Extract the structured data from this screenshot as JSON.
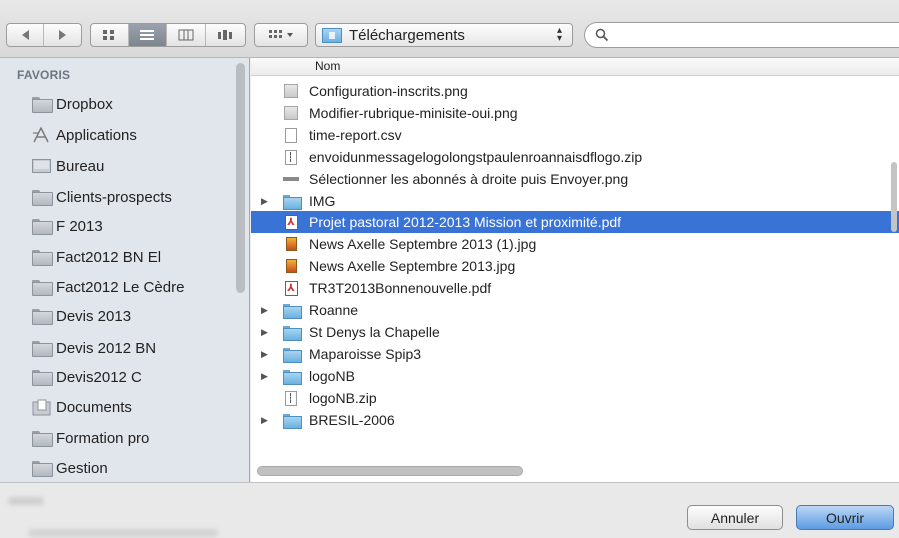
{
  "toolbar": {
    "location": "Téléchargements",
    "search_placeholder": ""
  },
  "sidebar": {
    "header": "FAVORIS",
    "items": [
      {
        "label": "Dropbox",
        "icon": "folder-icon"
      },
      {
        "label": "Applications",
        "icon": "applications-icon"
      },
      {
        "label": "Bureau",
        "icon": "desktop-icon"
      },
      {
        "label": "Clients-prospects",
        "icon": "folder-icon"
      },
      {
        "label": "F 2013",
        "icon": "folder-icon"
      },
      {
        "label": "Fact2012 BN El",
        "icon": "folder-icon"
      },
      {
        "label": "Fact2012 Le Cèdre",
        "icon": "folder-icon"
      },
      {
        "label": "Devis 2013",
        "icon": "folder-icon"
      },
      {
        "label": "Devis 2012 BN",
        "icon": "folder-icon"
      },
      {
        "label": "Devis2012 C",
        "icon": "folder-icon"
      },
      {
        "label": "Documents",
        "icon": "documents-icon"
      },
      {
        "label": "Formation pro",
        "icon": "folder-icon"
      },
      {
        "label": "Gestion",
        "icon": "folder-icon"
      }
    ]
  },
  "filelist": {
    "column_name": "Nom",
    "rows": [
      {
        "name": "Configuration-inscrits.png",
        "type": "png",
        "folder": false
      },
      {
        "name": "Modifier-rubrique-minisite-oui.png",
        "type": "png",
        "folder": false
      },
      {
        "name": "time-report.csv",
        "type": "doc",
        "folder": false
      },
      {
        "name": "envoidunmessagelogolongstpaulenroannaisdflogo.zip",
        "type": "zip",
        "folder": false
      },
      {
        "name": "Sélectionner les abonnés à droite puis Envoyer.png",
        "type": "bar",
        "folder": false
      },
      {
        "name": "IMG",
        "type": "folder",
        "folder": true
      },
      {
        "name": "Projet pastoral 2012-2013 Mission et proximité.pdf",
        "type": "pdf",
        "folder": false,
        "selected": true
      },
      {
        "name": "News Axelle Septembre 2013 (1).jpg",
        "type": "jpg",
        "folder": false
      },
      {
        "name": "News Axelle Septembre 2013.jpg",
        "type": "jpg",
        "folder": false
      },
      {
        "name": "TR3T2013Bonnenouvelle.pdf",
        "type": "pdf",
        "folder": false
      },
      {
        "name": "Roanne",
        "type": "folder",
        "folder": true
      },
      {
        "name": "St Denys la Chapelle",
        "type": "folder",
        "folder": true
      },
      {
        "name": "Maparoisse Spip3",
        "type": "folder",
        "folder": true
      },
      {
        "name": "logoNB",
        "type": "folder",
        "folder": true
      },
      {
        "name": "logoNB.zip",
        "type": "zip",
        "folder": false
      },
      {
        "name": "BRESIL-2006",
        "type": "folder",
        "folder": true
      }
    ]
  },
  "buttons": {
    "cancel": "Annuler",
    "open": "Ouvrir"
  },
  "colors": {
    "selection": "#3a73d6",
    "sidebar_bg": "#e1e5ec",
    "default_button": "#5d9be2"
  }
}
